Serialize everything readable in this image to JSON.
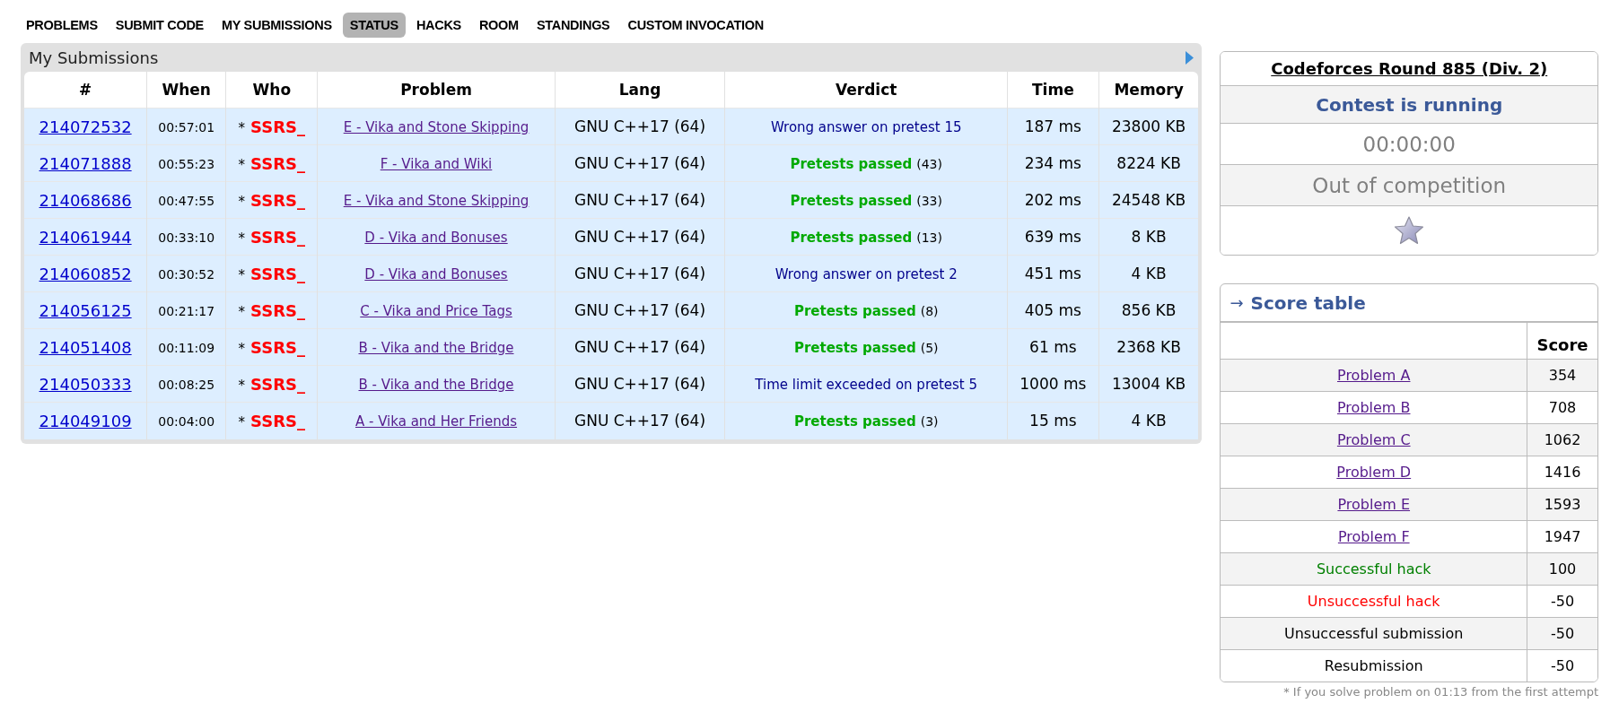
{
  "tabs": [
    {
      "label": "PROBLEMS",
      "selected": false
    },
    {
      "label": "SUBMIT CODE",
      "selected": false
    },
    {
      "label": "MY SUBMISSIONS",
      "selected": false
    },
    {
      "label": "STATUS",
      "selected": true
    },
    {
      "label": "HACKS",
      "selected": false
    },
    {
      "label": "ROOM",
      "selected": false
    },
    {
      "label": "STANDINGS",
      "selected": false
    },
    {
      "label": "CUSTOM INVOCATION",
      "selected": false
    }
  ],
  "submissions": {
    "title": "My Submissions",
    "columns": [
      "#",
      "When",
      "Who",
      "Problem",
      "Lang",
      "Verdict",
      "Time",
      "Memory"
    ],
    "rows": [
      {
        "id": "214072532",
        "when": "00:57:01",
        "who_mark": "*",
        "who": "SSRS_",
        "problem": "E - Vika and Stone Skipping",
        "lang": "GNU C++17 (64)",
        "verdict": {
          "kind": "rejected",
          "text": "Wrong answer on pretest 15"
        },
        "time": "187 ms",
        "memory": "23800 KB"
      },
      {
        "id": "214071888",
        "when": "00:55:23",
        "who_mark": "*",
        "who": "SSRS_",
        "problem": "F - Vika and Wiki",
        "lang": "GNU C++17 (64)",
        "verdict": {
          "kind": "passed",
          "text": "Pretests passed",
          "count": "(43)"
        },
        "time": "234 ms",
        "memory": "8224 KB"
      },
      {
        "id": "214068686",
        "when": "00:47:55",
        "who_mark": "*",
        "who": "SSRS_",
        "problem": "E - Vika and Stone Skipping",
        "lang": "GNU C++17 (64)",
        "verdict": {
          "kind": "passed",
          "text": "Pretests passed",
          "count": "(33)"
        },
        "time": "202 ms",
        "memory": "24548 KB"
      },
      {
        "id": "214061944",
        "when": "00:33:10",
        "who_mark": "*",
        "who": "SSRS_",
        "problem": "D - Vika and Bonuses",
        "lang": "GNU C++17 (64)",
        "verdict": {
          "kind": "passed",
          "text": "Pretests passed",
          "count": "(13)"
        },
        "time": "639 ms",
        "memory": "8 KB"
      },
      {
        "id": "214060852",
        "when": "00:30:52",
        "who_mark": "*",
        "who": "SSRS_",
        "problem": "D - Vika and Bonuses",
        "lang": "GNU C++17 (64)",
        "verdict": {
          "kind": "rejected",
          "text": "Wrong answer on pretest 2"
        },
        "time": "451 ms",
        "memory": "4 KB"
      },
      {
        "id": "214056125",
        "when": "00:21:17",
        "who_mark": "*",
        "who": "SSRS_",
        "problem": "C - Vika and Price Tags",
        "lang": "GNU C++17 (64)",
        "verdict": {
          "kind": "passed",
          "text": "Pretests passed",
          "count": "(8)"
        },
        "time": "405 ms",
        "memory": "856 KB"
      },
      {
        "id": "214051408",
        "when": "00:11:09",
        "who_mark": "*",
        "who": "SSRS_",
        "problem": "B - Vika and the Bridge",
        "lang": "GNU C++17 (64)",
        "verdict": {
          "kind": "passed",
          "text": "Pretests passed",
          "count": "(5)"
        },
        "time": "61 ms",
        "memory": "2368 KB"
      },
      {
        "id": "214050333",
        "when": "00:08:25",
        "who_mark": "*",
        "who": "SSRS_",
        "problem": "B - Vika and the Bridge",
        "lang": "GNU C++17 (64)",
        "verdict": {
          "kind": "rejected",
          "text": "Time limit exceeded on pretest 5"
        },
        "time": "1000 ms",
        "memory": "13004 KB"
      },
      {
        "id": "214049109",
        "when": "00:04:00",
        "who_mark": "*",
        "who": "SSRS_",
        "problem": "A - Vika and Her Friends",
        "lang": "GNU C++17 (64)",
        "verdict": {
          "kind": "passed",
          "text": "Pretests passed",
          "count": "(3)"
        },
        "time": "15 ms",
        "memory": "4 KB"
      }
    ]
  },
  "contest": {
    "title": "Codeforces Round 885 (Div. 2)",
    "status": "Contest is running",
    "timer": "00:00:00",
    "participation": "Out of competition"
  },
  "score_table": {
    "title": "Score table",
    "arrow": "→",
    "column": "Score",
    "rows": [
      {
        "kind": "link",
        "label": "Problem A",
        "score": "354"
      },
      {
        "kind": "link",
        "label": "Problem B",
        "score": "708"
      },
      {
        "kind": "link",
        "label": "Problem C",
        "score": "1062"
      },
      {
        "kind": "link",
        "label": "Problem D",
        "score": "1416"
      },
      {
        "kind": "link",
        "label": "Problem E",
        "score": "1593"
      },
      {
        "kind": "link",
        "label": "Problem F",
        "score": "1947"
      },
      {
        "kind": "good",
        "label": "Successful hack",
        "score": "100"
      },
      {
        "kind": "bad",
        "label": "Unsuccessful hack",
        "score": "-50"
      },
      {
        "kind": "plain",
        "label": "Unsuccessful submission",
        "score": "-50"
      },
      {
        "kind": "plain",
        "label": "Resubmission",
        "score": "-50"
      }
    ],
    "note": "* If you solve problem on 01:13 from the first attempt"
  }
}
